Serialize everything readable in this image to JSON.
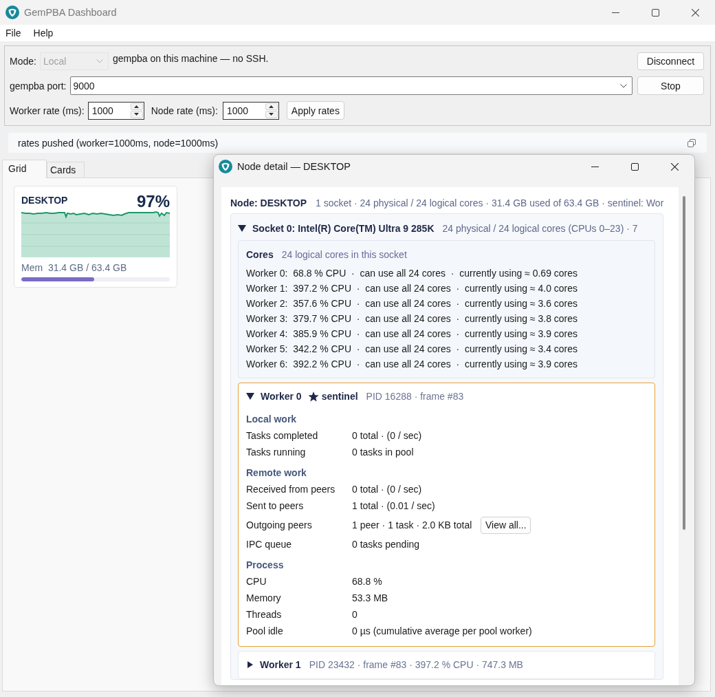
{
  "window": {
    "title": "GemPBA Dashboard"
  },
  "menu": [
    {
      "label": "File"
    },
    {
      "label": "Help"
    }
  ],
  "connection": {
    "mode_label": "Mode:",
    "mode": {
      "value": "Local",
      "disabled": true
    },
    "mode_note": "gempba on this machine — no SSH.",
    "disconnect_button": "Disconnect",
    "port_label": "gempba port:",
    "port": "9000",
    "stop_button": "Stop",
    "worker_rate_label": "Worker rate (ms):",
    "worker_rate": "1000",
    "node_rate_label": "Node rate (ms):",
    "node_rate": "1000",
    "apply_button": "Apply rates"
  },
  "status_message": "rates pushed (worker=1000ms, node=1000ms)",
  "tabs": [
    {
      "label": "Grid",
      "selected": true
    },
    {
      "label": "Cards",
      "selected": false
    }
  ],
  "node_cards": [
    {
      "name": "DESKTOP",
      "cpu": "97%",
      "memory": "Mem  31.4 GB / 63.4 GB",
      "level": 0.49
    }
  ],
  "node_detail": {
    "title": "Node detail — DESKTOP",
    "node_label": "Node: DESKTOP",
    "node_summary": "1 socket · 24 physical / 24 logical cores · 31.4 GB used of 63.4 GB · sentinel: Wor",
    "sockets": [
      {
        "title": "Socket 0: Intel(R) Core(TM) Ultra 9 285K",
        "summary": "24 physical / 24 logical cores (CPUs 0–23) · 7",
        "expanded": true,
        "cores": {
          "title": "Cores",
          "subtitle": "24 logical cores in this socket",
          "lines": [
            "Worker 0:  68.8 % CPU  ·  can use all 24 cores  ·  currently using ≈ 0.69 cores",
            "Worker 1:  397.2 % CPU  ·  can use all 24 cores  ·  currently using ≈ 4.0 cores",
            "Worker 2:  357.6 % CPU  ·  can use all 24 cores  ·  currently using ≈ 3.6 cores",
            "Worker 3:  379.7 % CPU  ·  can use all 24 cores  ·  currently using ≈ 3.8 cores",
            "Worker 4:  385.9 % CPU  ·  can use all 24 cores  ·  currently using ≈ 3.9 cores",
            "Worker 5:  342.2 % CPU  ·  can use all 24 cores  ·  currently using ≈ 3.4 cores",
            "Worker 6:  392.2 % CPU  ·  can use all 24 cores  ·  currently using ≈ 3.9 cores"
          ]
        },
        "workers": [
          {
            "title": "Worker 0",
            "badge": "sentinel",
            "info": "PID 16288 · frame #83",
            "expanded": true,
            "selected": true,
            "sections": [
              {
                "title": "Local work",
                "rows": [
                  {
                    "label": "Tasks completed",
                    "value": "0 total · (0 / sec)"
                  },
                  {
                    "label": "Tasks running",
                    "value": "0 tasks in pool"
                  }
                ]
              },
              {
                "title": "Remote work",
                "rows": [
                  {
                    "label": "Received from peers",
                    "value": "0 total · (0 / sec)"
                  },
                  {
                    "label": "Sent to peers",
                    "value": "1 total · (0.01 / sec)"
                  },
                  {
                    "label": "Outgoing peers",
                    "value": "1 peer · 1 task · 2.0 KB total",
                    "button": "View all..."
                  },
                  {
                    "label": "IPC queue",
                    "value": "0 tasks pending"
                  }
                ]
              },
              {
                "title": "Process",
                "rows": [
                  {
                    "label": "CPU",
                    "value": "68.8 %"
                  },
                  {
                    "label": "Memory",
                    "value": "53.3 MB"
                  },
                  {
                    "label": "Threads",
                    "value": "0"
                  },
                  {
                    "label": "Pool idle",
                    "value": "0 µs (cumulative average per pool worker)"
                  }
                ]
              }
            ]
          },
          {
            "title": "Worker 1",
            "info": "PID 23432 · frame #83 · 397.2 % CPU · 747.3 MB",
            "expanded": false,
            "selected": false
          }
        ]
      }
    ]
  }
}
